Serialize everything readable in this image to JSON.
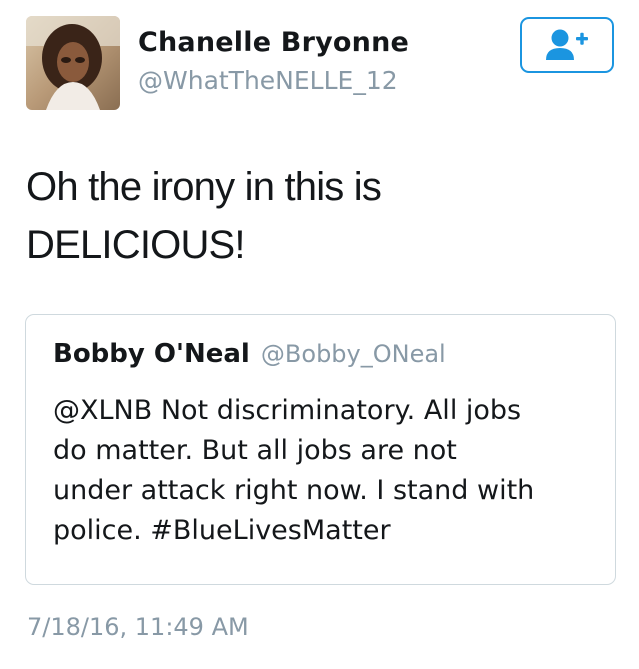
{
  "author": {
    "display_name": "Chanelle Bryonne",
    "handle": "@WhatTheNELLE_12",
    "avatar_icon": "profile-photo"
  },
  "follow_button": {
    "icon": "follow-user-plus-icon",
    "color": "#1b95e0"
  },
  "tweet": {
    "text_lines": [
      "Oh the irony in this is",
      "DELICIOUS!"
    ],
    "timestamp": "7/18/16, 11:49 AM"
  },
  "quoted_tweet": {
    "display_name": "Bobby O'Neal",
    "handle": "@Bobby_ONeal",
    "text_lines": [
      "@XLNB Not discriminatory. All jobs",
      "do matter. But all jobs are not",
      "under attack right now. I stand with",
      "police. #BlueLivesMatter"
    ]
  },
  "colors": {
    "primary_text": "#14171a",
    "secondary_text": "#8899a6",
    "accent": "#1b95e0",
    "card_border": "#cfd9de"
  }
}
